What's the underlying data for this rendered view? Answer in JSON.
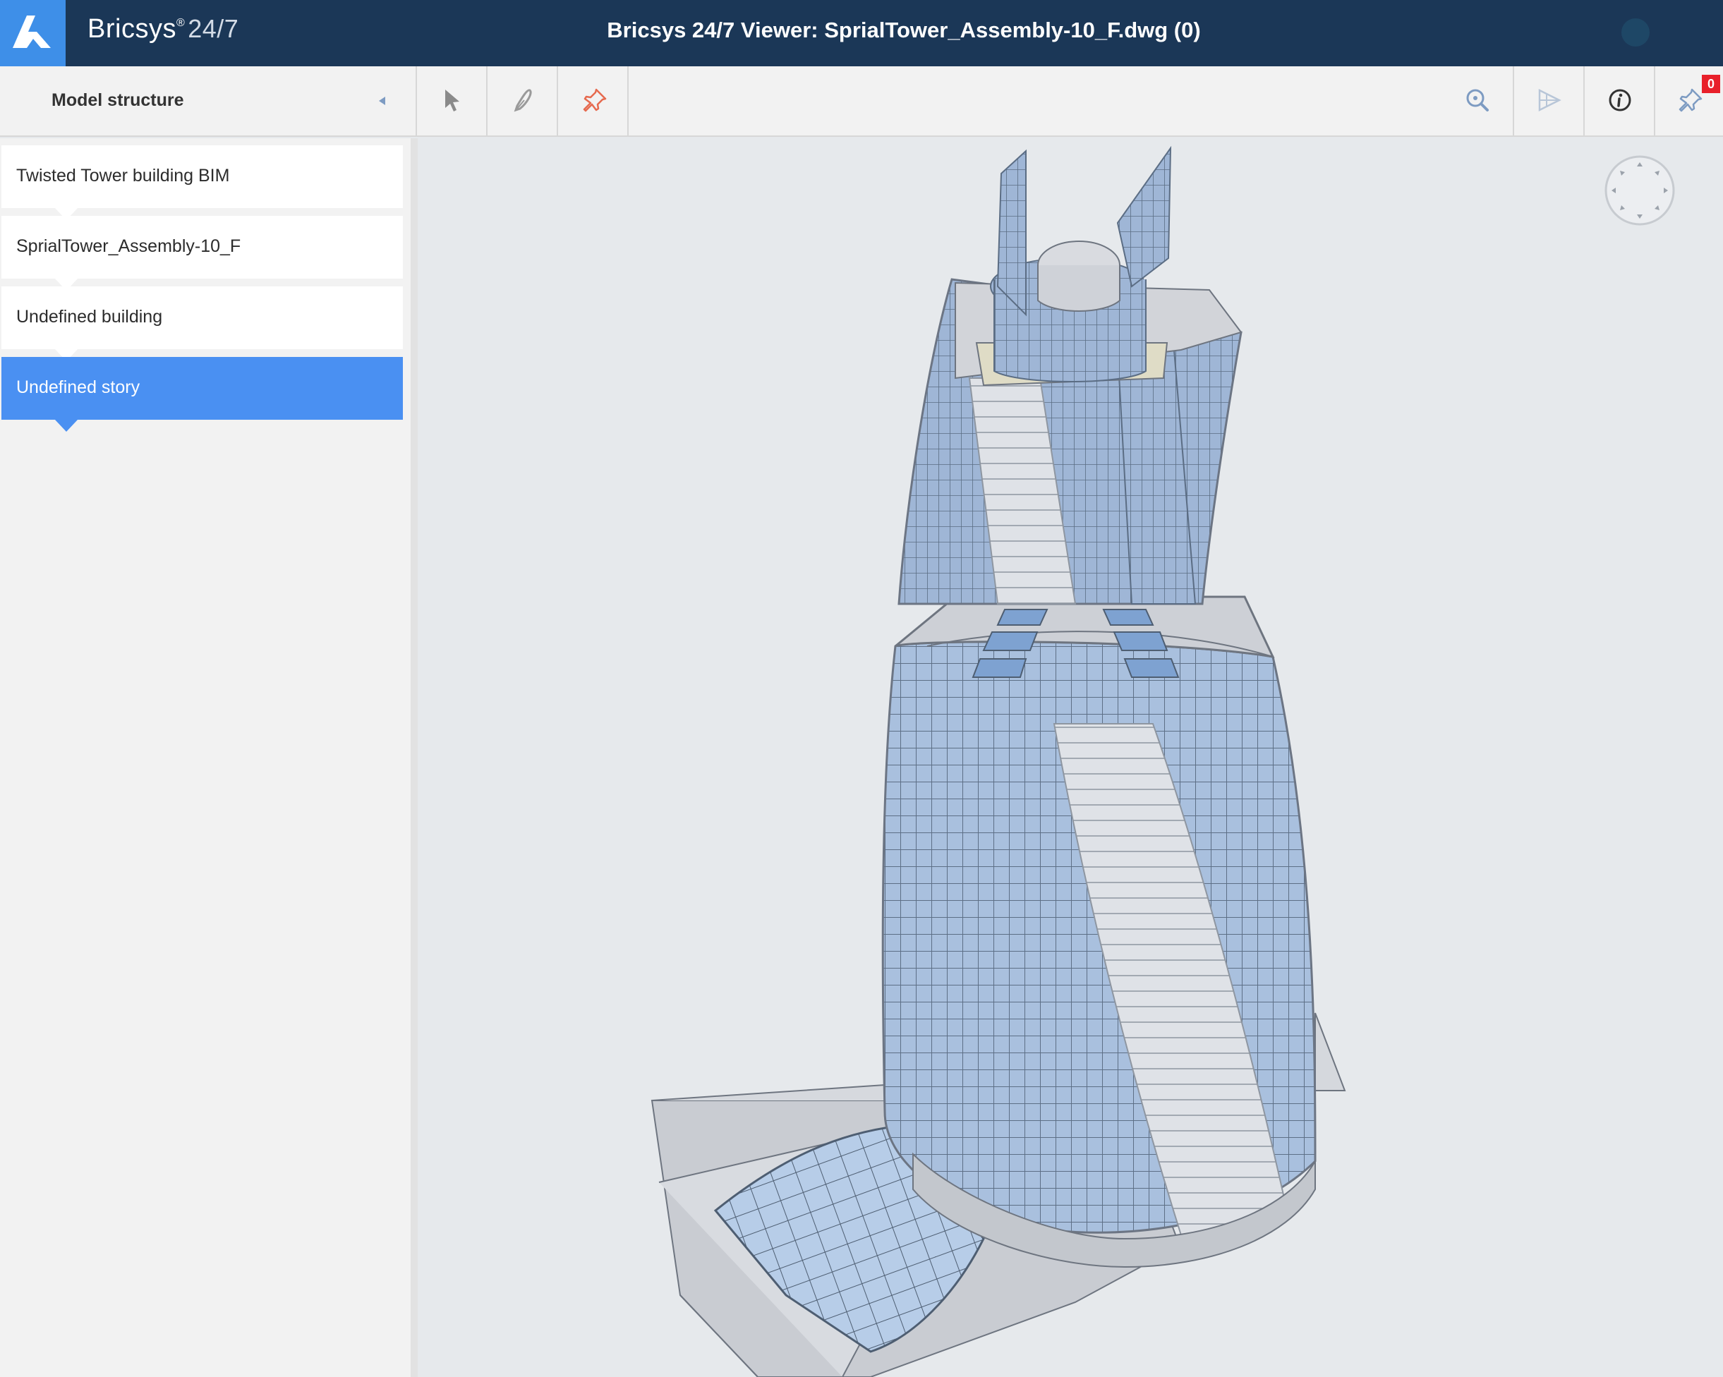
{
  "header": {
    "brand": "Bricsys",
    "brand_mark": "®",
    "brand_version": "24/7",
    "title": "Bricsys 24/7 Viewer: SprialTower_Assembly-10_F.dwg (0)"
  },
  "sidebar": {
    "title": "Model structure",
    "items": [
      {
        "label": "Twisted Tower building BIM",
        "selected": false
      },
      {
        "label": "SprialTower_Assembly-10_F",
        "selected": false
      },
      {
        "label": "Undefined building",
        "selected": false
      },
      {
        "label": "Undefined story",
        "selected": true
      }
    ]
  },
  "toolbar": {
    "left_tools": [
      "select-arrow-icon",
      "markup-pen-icon",
      "pin-icon"
    ],
    "right_tools": [
      "zoom-icon",
      "section-plane-icon",
      "info-icon",
      "pin-list-icon"
    ],
    "pin_count": "0"
  },
  "colors": {
    "header_bg": "#1b3757",
    "logo_bg": "#3e8fe8",
    "selected_item": "#4a90f2",
    "badge": "#e8202a",
    "pin_tool": "#e66a4f"
  }
}
